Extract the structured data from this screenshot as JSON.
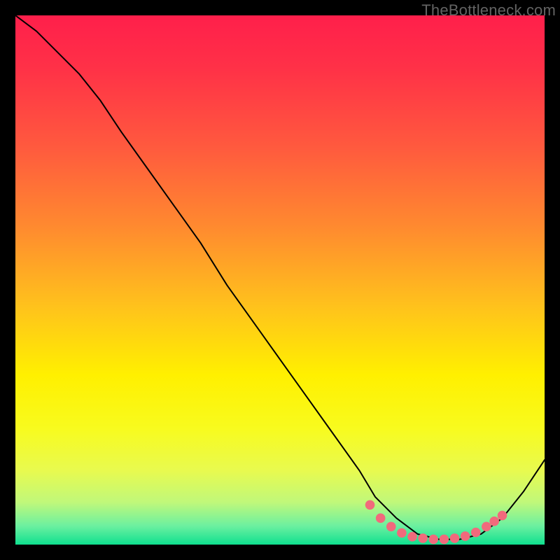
{
  "watermark": "TheBottleneck.com",
  "colors": {
    "gradient_stops": [
      {
        "offset": 0.0,
        "color": "#ff1f4b"
      },
      {
        "offset": 0.1,
        "color": "#ff3147"
      },
      {
        "offset": 0.25,
        "color": "#ff5a3e"
      },
      {
        "offset": 0.4,
        "color": "#ff8a2f"
      },
      {
        "offset": 0.55,
        "color": "#ffc21c"
      },
      {
        "offset": 0.68,
        "color": "#fff000"
      },
      {
        "offset": 0.78,
        "color": "#f8fb1e"
      },
      {
        "offset": 0.86,
        "color": "#e8fa4f"
      },
      {
        "offset": 0.92,
        "color": "#c0f87a"
      },
      {
        "offset": 0.965,
        "color": "#6bf0a0"
      },
      {
        "offset": 1.0,
        "color": "#0fe08f"
      }
    ],
    "curve": "#000000",
    "dots": "#f16a7c",
    "frame": "#000000"
  },
  "chart_data": {
    "type": "line",
    "title": "",
    "xlabel": "",
    "ylabel": "",
    "xlim": [
      0,
      100
    ],
    "ylim": [
      0,
      100
    ],
    "series": [
      {
        "name": "curve",
        "x": [
          0,
          4,
          8,
          12,
          16,
          20,
          25,
          30,
          35,
          40,
          45,
          50,
          55,
          60,
          65,
          68,
          72,
          76,
          80,
          84,
          88,
          92,
          96,
          100
        ],
        "y": [
          100,
          97,
          93,
          89,
          84,
          78,
          71,
          64,
          57,
          49,
          42,
          35,
          28,
          21,
          14,
          9,
          5,
          2,
          1,
          1,
          2,
          5,
          10,
          16
        ]
      }
    ],
    "markers": {
      "name": "valley-dots",
      "x": [
        67,
        69,
        71,
        73,
        75,
        77,
        79,
        81,
        83,
        85,
        87,
        89,
        90.5,
        92
      ],
      "y": [
        7.5,
        5.0,
        3.4,
        2.2,
        1.5,
        1.2,
        1.0,
        1.0,
        1.2,
        1.6,
        2.3,
        3.4,
        4.4,
        5.5
      ]
    }
  }
}
